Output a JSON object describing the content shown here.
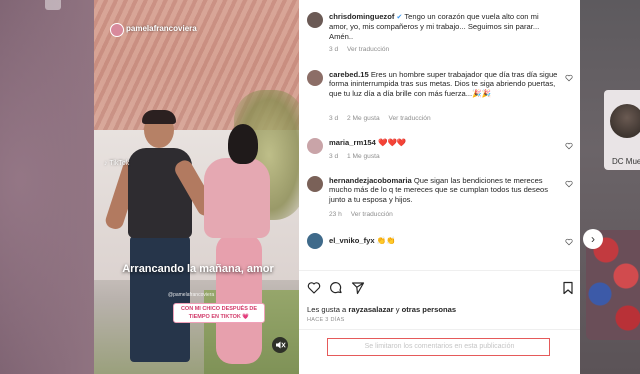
{
  "video": {
    "username": "pamelafrancoviera",
    "tiktok_label": "TikTok",
    "caption": "Arrancando la mañana, amor",
    "watermark": "@pamelafrancoviera",
    "sticker_text": "CON MI CHICO DESPUÉS DE TIEMPO EN TIKTOK 💗",
    "mute_icon": "speaker-muted-icon"
  },
  "comments": [
    {
      "user": "chrisdominguezof",
      "verified": true,
      "text": "Tengo un corazón que vuela alto con mi amor, yo, mis compañeros y mi trabajo... Seguimos sin parar... Amén..",
      "time": "3 d",
      "likes": "",
      "reply": "Ver traducción",
      "avatar_color": "#6b5a55"
    },
    {
      "user": "carebed.15",
      "verified": false,
      "text": "Eres un hombre super trabajador que día tras día sigue forma ininterrumpida tras sus metas. Dios te siga abriendo puertas, que tu luz día a día brille con más fuerza...🎉🎉",
      "time": "3 d",
      "likes": "2 Me gusta",
      "reply": "Ver traducción",
      "avatar_color": "#8c6e67"
    },
    {
      "user": "maria_rm154",
      "verified": false,
      "text": "❤️❤️❤️",
      "time": "3 d",
      "likes": "1 Me gusta",
      "reply": "",
      "avatar_color": "#c9a4a8"
    },
    {
      "user": "hernandezjacobomaria",
      "verified": false,
      "text": "Que sigan las bendiciones te mereces mucho más de lo q te mereces que se cumplan todos tus deseos junto a tu esposa y hijos.",
      "time": "23 h",
      "likes": "",
      "reply": "Ver traducción",
      "avatar_color": "#7a6158"
    },
    {
      "user": "el_vniko_fyx",
      "verified": false,
      "text": "👏👏",
      "time": "",
      "likes": "",
      "reply": "",
      "avatar_color": "#3f6a8a"
    }
  ],
  "actions": {
    "like_icon": "heart-icon",
    "comment_icon": "comment-icon",
    "share_icon": "share-icon",
    "save_icon": "bookmark-icon"
  },
  "likes_summary": {
    "prefix": "Les gusta a",
    "user": "rayzasalazar",
    "middle": "y",
    "others": "otras personas"
  },
  "time_ago": "HACE 3 DÍAS",
  "comments_limited": "Se limitaron los comentarios en esta publicación",
  "right_side": {
    "label": "DC Muebl"
  },
  "colors": {
    "highlight_border": "#e55a5a",
    "heart_red": "#e0245e"
  }
}
